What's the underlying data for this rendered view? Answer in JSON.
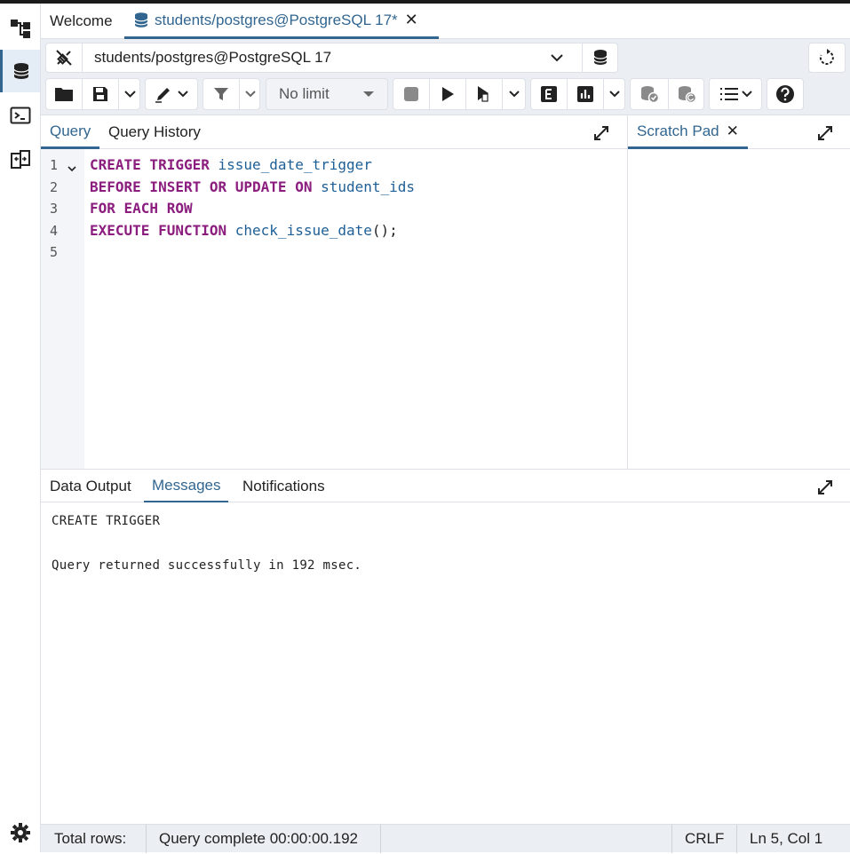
{
  "tabs": {
    "welcome": "Welcome",
    "query_tool": "students/postgres@PostgreSQL 17*"
  },
  "connection": {
    "selected": "students/postgres@PostgreSQL 17"
  },
  "toolbar": {
    "limit": "No limit"
  },
  "editor_tabs": {
    "query": "Query",
    "history": "Query History"
  },
  "scratch": {
    "title": "Scratch Pad"
  },
  "editor": {
    "line_numbers": [
      "1",
      "2",
      "3",
      "4",
      "5"
    ],
    "lines": [
      [
        {
          "t": "kw",
          "v": "CREATE TRIGGER "
        },
        {
          "t": "id",
          "v": "issue_date_trigger"
        }
      ],
      [
        {
          "t": "kw",
          "v": "BEFORE INSERT OR UPDATE ON "
        },
        {
          "t": "id",
          "v": "student_ids"
        }
      ],
      [
        {
          "t": "kw",
          "v": "FOR EACH ROW"
        }
      ],
      [
        {
          "t": "kw",
          "v": "EXECUTE FUNCTION "
        },
        {
          "t": "id",
          "v": "check_issue_date"
        },
        {
          "t": "pn",
          "v": "();"
        }
      ],
      []
    ]
  },
  "output_tabs": {
    "data_output": "Data Output",
    "messages": "Messages",
    "notifications": "Notifications"
  },
  "messages": {
    "line1": "CREATE TRIGGER",
    "line2": "Query returned successfully in 192 msec."
  },
  "status": {
    "total_rows": "Total rows:",
    "query_complete": "Query complete 00:00:00.192",
    "eol": "CRLF",
    "position": "Ln 5, Col 1"
  },
  "colors": {
    "accent": "#326690",
    "keyword": "#8b1d7e",
    "identifier": "#1e5f96"
  }
}
